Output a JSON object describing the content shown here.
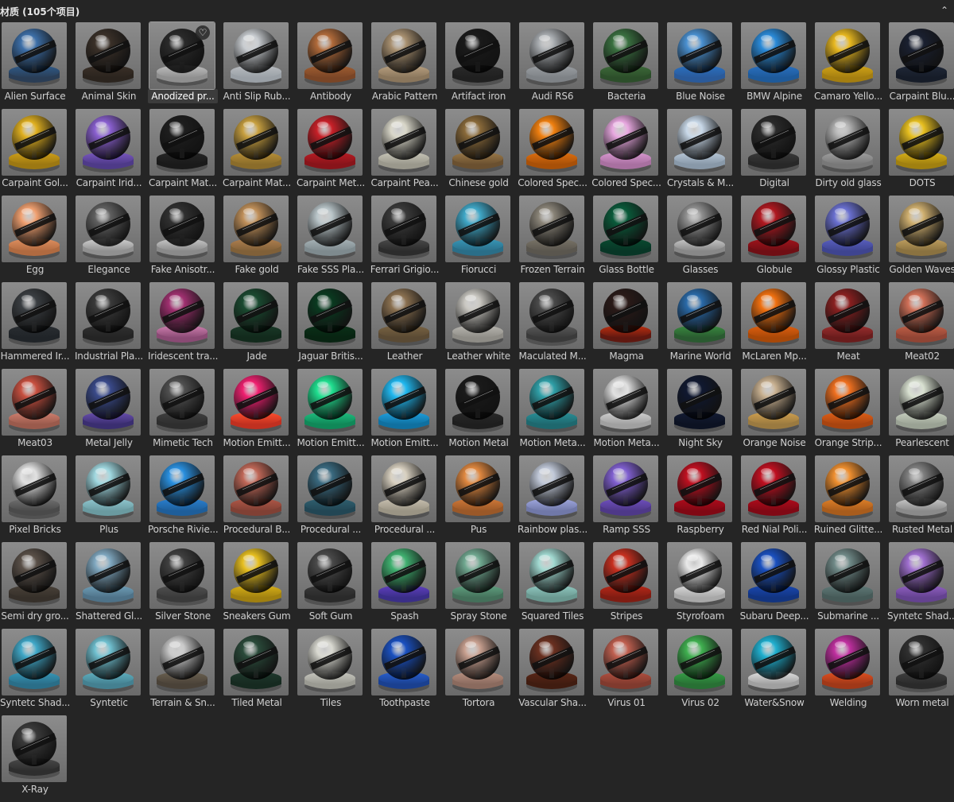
{
  "header": {
    "title": "材质 (105个项目)",
    "collapse_icon": "chevron-up-icon"
  },
  "selected_index": 2,
  "favorite_icon": "heart-icon",
  "materials": [
    {
      "name": "Alien Surface",
      "color": "#3d6fa8",
      "ring": "#2f5b8a",
      "base": "#2a3d55"
    },
    {
      "name": "Animal Skin",
      "color": "#3a3028",
      "ring": "#3a3028",
      "base": "#2b241e"
    },
    {
      "name": "Anodized pr...",
      "color": "#2a2a2a",
      "ring": "#bdbdbd",
      "base": "#8f8f8f"
    },
    {
      "name": "Anti Slip Rub...",
      "color": "#c8ccd0",
      "ring": "#b8bcc0",
      "base": "#9aa0a6"
    },
    {
      "name": "Antibody",
      "color": "#b06a3a",
      "ring": "#a05e32",
      "base": "#7a4526"
    },
    {
      "name": "Arabic Pattern",
      "color": "#a89070",
      "ring": "#b8a080",
      "base": "#8a765c"
    },
    {
      "name": "Artifact iron",
      "color": "#1a1a1a",
      "ring": "#2a2a2a",
      "base": "#202020"
    },
    {
      "name": "Audi RS6",
      "color": "#a8acb0",
      "ring": "#9a9ea2",
      "base": "#7e8286"
    },
    {
      "name": "Bacteria",
      "color": "#3a7040",
      "ring": "#3d6a3a",
      "base": "#2c4e2a"
    },
    {
      "name": "Blue Noise",
      "color": "#4a90d0",
      "ring": "#2a70c0",
      "base": "#2a5a9a"
    },
    {
      "name": "BMW Alpine",
      "color": "#2a8ad8",
      "ring": "#2a70c0",
      "base": "#1e5a9a"
    },
    {
      "name": "Camaro Yello...",
      "color": "#e8b820",
      "ring": "#d0a418",
      "base": "#a47e10"
    },
    {
      "name": "Carpaint Blu...",
      "color": "#1a2030",
      "ring": "#202838",
      "base": "#161c28"
    },
    {
      "name": "Carpaint Gol...",
      "color": "#e0b020",
      "ring": "#d0a018",
      "base": "#9c7812"
    },
    {
      "name": "Carpaint Irid...",
      "color": "#8a60d0",
      "ring": "#7a58c0",
      "base": "#4e3a88"
    },
    {
      "name": "Carpaint Mat...",
      "color": "#1e1e1e",
      "ring": "#262626",
      "base": "#1a1a1a"
    },
    {
      "name": "Carpaint Mat...",
      "color": "#c8a040",
      "ring": "#b89038",
      "base": "#8a6c2a"
    },
    {
      "name": "Carpaint Met...",
      "color": "#c82028",
      "ring": "#b81c24",
      "base": "#88141a"
    },
    {
      "name": "Carpaint Pea...",
      "color": "#d8d6c8",
      "ring": "#c8c6b8",
      "base": "#9a988c"
    },
    {
      "name": "Chinese gold",
      "color": "#8a6a3a",
      "ring": "#9a7a4a",
      "base": "#6a5030"
    },
    {
      "name": "Colored Spec...",
      "color": "#f08010",
      "ring": "#e07010",
      "base": "#a85008"
    },
    {
      "name": "Colored Spec...",
      "color": "#e8a8e0",
      "ring": "#d898d0",
      "base": "#a870a0"
    },
    {
      "name": "Crystals & M...",
      "color": "#c8d8e8",
      "ring": "#b8c8d8",
      "base": "#8898a8"
    },
    {
      "name": "Digital",
      "color": "#2a2a2a",
      "ring": "#3a3a3a",
      "base": "#282828"
    },
    {
      "name": "Dirty old glass",
      "color": "#b0b0b0",
      "ring": "#a0a0a0",
      "base": "#787878"
    },
    {
      "name": "DOTS",
      "color": "#e8c020",
      "ring": "#d8b018",
      "base": "#a08010"
    },
    {
      "name": "Egg",
      "color": "#f0a070",
      "ring": "#e09060",
      "base": "#b06a40"
    },
    {
      "name": "Elegance",
      "color": "#606060",
      "ring": "#d0d0d0",
      "base": "#909090"
    },
    {
      "name": "Fake Anisotr...",
      "color": "#303030",
      "ring": "#c8c8c8",
      "base": "#8a8a8a"
    },
    {
      "name": "Fake gold",
      "color": "#c0905a",
      "ring": "#b08050",
      "base": "#806038"
    },
    {
      "name": "Fake SSS Pla...",
      "color": "#b8c4c8",
      "ring": "#a8b4b8",
      "base": "#7e8a8e"
    },
    {
      "name": "Ferrari Grigio...",
      "color": "#3a3a3a",
      "ring": "#4a4a4a",
      "base": "#2c2c2c"
    },
    {
      "name": "Fiorucci",
      "color": "#40a8c8",
      "ring": "#3898b8",
      "base": "#2a6e88"
    },
    {
      "name": "Frozen Terrain",
      "color": "#8a8478",
      "ring": "#7a7468",
      "base": "#5a564e"
    },
    {
      "name": "Glass Bottle",
      "color": "#0a5a3a",
      "ring": "#0a4a30",
      "base": "#083626"
    },
    {
      "name": "Glasses",
      "color": "#909090",
      "ring": "#c8c8c8",
      "base": "#888888"
    },
    {
      "name": "Globule",
      "color": "#b01820",
      "ring": "#a0141c",
      "base": "#700e14"
    },
    {
      "name": "Glossy Plastic",
      "color": "#6a70d0",
      "ring": "#5a60c0",
      "base": "#3e4490"
    },
    {
      "name": "Golden Waves",
      "color": "#d0b070",
      "ring": "#c0a060",
      "base": "#8a7240"
    },
    {
      "name": "Hammered Ir...",
      "color": "#3a3e42",
      "ring": "#2a2e32",
      "base": "#202428"
    },
    {
      "name": "Industrial Pla...",
      "color": "#3a3a3a",
      "ring": "#303030",
      "base": "#242424"
    },
    {
      "name": "Iridescent tra...",
      "color": "#a03070",
      "ring": "#d080b0",
      "base": "#8a4a74"
    },
    {
      "name": "Jade",
      "color": "#1a4a30",
      "ring": "#1a3a28",
      "base": "#122a1c"
    },
    {
      "name": "Jaguar Britis...",
      "color": "#0a3a20",
      "ring": "#0a3018",
      "base": "#082412"
    },
    {
      "name": "Leather",
      "color": "#8a7050",
      "ring": "#7a6444",
      "base": "#5a4a34"
    },
    {
      "name": "Leather white",
      "color": "#c8c6c0",
      "ring": "#b8b6b0",
      "base": "#8e8c86"
    },
    {
      "name": "Maculated M...",
      "color": "#4a4a4a",
      "ring": "#5a5a5a",
      "base": "#3a3a3a"
    },
    {
      "name": "Magma",
      "color": "#2a1a18",
      "ring": "#c03010",
      "base": "#601810"
    },
    {
      "name": "Marine World",
      "color": "#2a6aa8",
      "ring": "#3a8a40",
      "base": "#2a5a30"
    },
    {
      "name": "McLaren Mp...",
      "color": "#f07010",
      "ring": "#e06010",
      "base": "#a84808"
    },
    {
      "name": "Meat",
      "color": "#8a2020",
      "ring": "#9a3030",
      "base": "#6a1c1c"
    },
    {
      "name": "Meat02",
      "color": "#d07058",
      "ring": "#c06048",
      "base": "#904434"
    },
    {
      "name": "Meat03",
      "color": "#c85040",
      "ring": "#d08070",
      "base": "#9a5a4c"
    },
    {
      "name": "Metal Jelly",
      "color": "#3a4a8a",
      "ring": "#6a50b0",
      "base": "#3a2e70"
    },
    {
      "name": "Mimetic Tech",
      "color": "#505050",
      "ring": "#404040",
      "base": "#2e2e2e"
    },
    {
      "name": "Motion Emitt...",
      "color": "#f02070",
      "ring": "#ff5030",
      "base": "#c03020"
    },
    {
      "name": "Motion Emitt...",
      "color": "#20e090",
      "ring": "#20c080",
      "base": "#108858"
    },
    {
      "name": "Motion Emitt...",
      "color": "#20b8f0",
      "ring": "#20a0e0",
      "base": "#1070a0"
    },
    {
      "name": "Motion Metal",
      "color": "#1a1a1a",
      "ring": "#2a2a2a",
      "base": "#1e1e1e"
    },
    {
      "name": "Motion Meta...",
      "color": "#30a0a8",
      "ring": "#2a9098",
      "base": "#1e686e"
    },
    {
      "name": "Motion Meta...",
      "color": "#e0e0e0",
      "ring": "#d0d0d0",
      "base": "#a0a0a0"
    },
    {
      "name": "Night Sky",
      "color": "#101830",
      "ring": "#141c34",
      "base": "#0c1222"
    },
    {
      "name": "Orange Noise",
      "color": "#c8b090",
      "ring": "#d0a050",
      "base": "#9a7a40"
    },
    {
      "name": "Orange Strip...",
      "color": "#f07020",
      "ring": "#e06018",
      "base": "#a84410"
    },
    {
      "name": "Pearlescent",
      "color": "#d8e0d0",
      "ring": "#c8d0c0",
      "base": "#9aa294"
    },
    {
      "name": "Pixel Bricks",
      "color": "#e0e0e0",
      "ring": "#707070",
      "base": "#4a4a4a"
    },
    {
      "name": "Plus",
      "color": "#a0d8e0",
      "ring": "#90c8d0",
      "base": "#6a9aa0"
    },
    {
      "name": "Porsche Rivie...",
      "color": "#2a90e0",
      "ring": "#2a80d0",
      "base": "#1e5e9a"
    },
    {
      "name": "Procedural B...",
      "color": "#c06858",
      "ring": "#b05848",
      "base": "#804034"
    },
    {
      "name": "Procedural ...",
      "color": "#3a6a80",
      "ring": "#306070",
      "base": "#224654"
    },
    {
      "name": "Procedural ...",
      "color": "#d8d0c0",
      "ring": "#c8c0b0",
      "base": "#9a9484"
    },
    {
      "name": "Pus",
      "color": "#e08840",
      "ring": "#d07838",
      "base": "#9a5828"
    },
    {
      "name": "Rainbow plas...",
      "color": "#c0c8d8",
      "ring": "#a0a8e0",
      "base": "#7078a8"
    },
    {
      "name": "Ramp SSS",
      "color": "#8060d0",
      "ring": "#7050c0",
      "base": "#4e3888"
    },
    {
      "name": "Raspberry",
      "color": "#c01020",
      "ring": "#b00c1c",
      "base": "#800814"
    },
    {
      "name": "Red Nial Poli...",
      "color": "#c01020",
      "ring": "#b00c1c",
      "base": "#800814"
    },
    {
      "name": "Ruined Glitte...",
      "color": "#f09030",
      "ring": "#e08028",
      "base": "#a85c1c"
    },
    {
      "name": "Rusted Metal",
      "color": "#808080",
      "ring": "#c8c8c8",
      "base": "#8a8a8a"
    },
    {
      "name": "Semi dry gro...",
      "color": "#5a5048",
      "ring": "#4a423a",
      "base": "#36302a"
    },
    {
      "name": "Shattered Gl...",
      "color": "#80a8c0",
      "ring": "#70a0b8",
      "base": "#4e7288"
    },
    {
      "name": "Silver Stone",
      "color": "#404040",
      "ring": "#505050",
      "base": "#3a3a3a"
    },
    {
      "name": "Sneakers Gum",
      "color": "#e8c020",
      "ring": "#d8b018",
      "base": "#a08010"
    },
    {
      "name": "Soft Gum",
      "color": "#4a4a4a",
      "ring": "#3a3a3a",
      "base": "#2a2a2a"
    },
    {
      "name": "Spash",
      "color": "#40b070",
      "ring": "#6040c0",
      "base": "#3a2e88"
    },
    {
      "name": "Spray Stone",
      "color": "#70a890",
      "ring": "#60a080",
      "base": "#44705a"
    },
    {
      "name": "Squared Tiles",
      "color": "#a0d8d0",
      "ring": "#90c8c0",
      "base": "#6a9890"
    },
    {
      "name": "Stripes",
      "color": "#c83020",
      "ring": "#b82818",
      "base": "#801c12"
    },
    {
      "name": "Styrofoam",
      "color": "#e8e8e8",
      "ring": "#d8d8d8",
      "base": "#a8a8a8"
    },
    {
      "name": "Subaru Deep...",
      "color": "#1a50c0",
      "ring": "#1a48b0",
      "base": "#123480"
    },
    {
      "name": "Submarine ...",
      "color": "#708a88",
      "ring": "#607a78",
      "base": "#465a58"
    },
    {
      "name": "Syntetc Shad...",
      "color": "#a070d0",
      "ring": "#9060c0",
      "base": "#644290"
    },
    {
      "name": "Syntetc Shad...",
      "color": "#40a8c8",
      "ring": "#3898b8",
      "base": "#2a6e88"
    },
    {
      "name": "Syntetic",
      "color": "#70c0d0",
      "ring": "#60b0c0",
      "base": "#448090"
    },
    {
      "name": "Terrain & Sn...",
      "color": "#c8c8c8",
      "ring": "#6a6050",
      "base": "#4a4238"
    },
    {
      "name": "Tiled Metal",
      "color": "#2a4a3a",
      "ring": "#203a2e",
      "base": "#162a20"
    },
    {
      "name": "Tiles",
      "color": "#d8d8d0",
      "ring": "#c8c8c0",
      "base": "#9a9a92"
    },
    {
      "name": "Toothpaste",
      "color": "#1a50c0",
      "ring": "#2a60d0",
      "base": "#1a4090"
    },
    {
      "name": "Tortora",
      "color": "#c8a090",
      "ring": "#b89080",
      "base": "#8a6a5e"
    },
    {
      "name": "Vascular Sha...",
      "color": "#6a3020",
      "ring": "#5a2818",
      "base": "#401c10"
    },
    {
      "name": "Virus 01",
      "color": "#c06050",
      "ring": "#b05040",
      "base": "#803a2e"
    },
    {
      "name": "Virus 02",
      "color": "#40b050",
      "ring": "#38a048",
      "base": "#287034"
    },
    {
      "name": "Water&Snow",
      "color": "#20b0d0",
      "ring": "#e0e0e0",
      "base": "#a0a0a0"
    },
    {
      "name": "Welding",
      "color": "#c030a0",
      "ring": "#e05020",
      "base": "#a03818"
    },
    {
      "name": "Worn metal",
      "color": "#303030",
      "ring": "#404040",
      "base": "#2a2a2a"
    },
    {
      "name": "X-Ray",
      "color": "#3a3a3a",
      "ring": "#4a4a4a",
      "base": "#2e2e2e"
    }
  ]
}
